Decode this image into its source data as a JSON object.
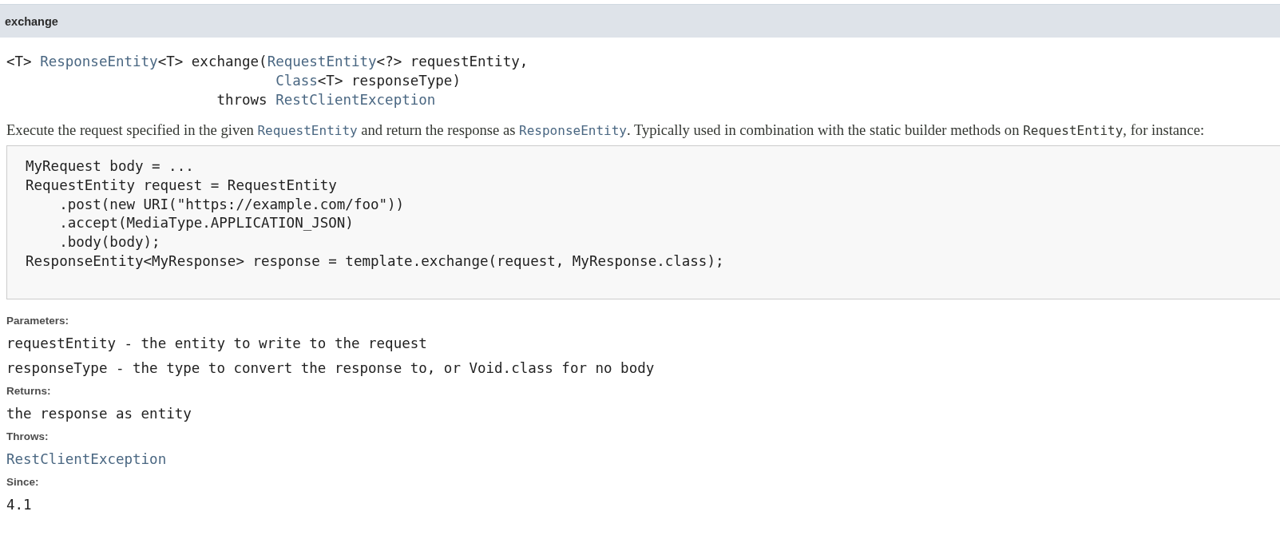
{
  "header": {
    "title": "exchange"
  },
  "signature": [
    [
      {
        "text": "<T> ",
        "kind": "text"
      },
      {
        "text": "ResponseEntity",
        "kind": "link"
      },
      {
        "text": "<T> exchange(",
        "kind": "text"
      },
      {
        "text": "RequestEntity",
        "kind": "link"
      },
      {
        "text": "<?> requestEntity,",
        "kind": "text"
      }
    ],
    [
      {
        "text": "Class",
        "kind": "link"
      },
      {
        "text": "<T> responseType)",
        "kind": "text"
      }
    ],
    [
      {
        "text": "throws ",
        "kind": "text"
      },
      {
        "text": "RestClientException",
        "kind": "link"
      }
    ]
  ],
  "description": [
    {
      "text": "Execute the request specified in the given ",
      "kind": "text"
    },
    {
      "text": "RequestEntity",
      "kind": "code-link"
    },
    {
      "text": " and return the response as ",
      "kind": "text"
    },
    {
      "text": "ResponseEntity",
      "kind": "code-link"
    },
    {
      "text": ". Typically used in combination with the static builder methods on ",
      "kind": "text"
    },
    {
      "text": "RequestEntity",
      "kind": "code"
    },
    {
      "text": ", for instance:",
      "kind": "text"
    }
  ],
  "code_block": [
    "MyRequest body = ...",
    "RequestEntity request = RequestEntity",
    "    .post(new URI(\"https://example.com/foo\"))",
    "    .accept(MediaType.APPLICATION_JSON)",
    "    .body(body);",
    "ResponseEntity<MyResponse> response = template.exchange(request, MyResponse.class);"
  ],
  "sections": [
    {
      "label": "Parameters:",
      "items": [
        {
          "text": "requestEntity - the entity to write to the request",
          "kind": "text"
        },
        {
          "text": "responseType - the type to convert the response to, or Void.class for no body",
          "kind": "text"
        }
      ]
    },
    {
      "label": "Returns:",
      "items": [
        {
          "text": "the response as entity",
          "kind": "text"
        }
      ]
    },
    {
      "label": "Throws:",
      "items": [
        {
          "text": "RestClientException",
          "kind": "link"
        }
      ]
    },
    {
      "label": "Since:",
      "items": [
        {
          "text": "4.1",
          "kind": "text"
        }
      ]
    }
  ]
}
